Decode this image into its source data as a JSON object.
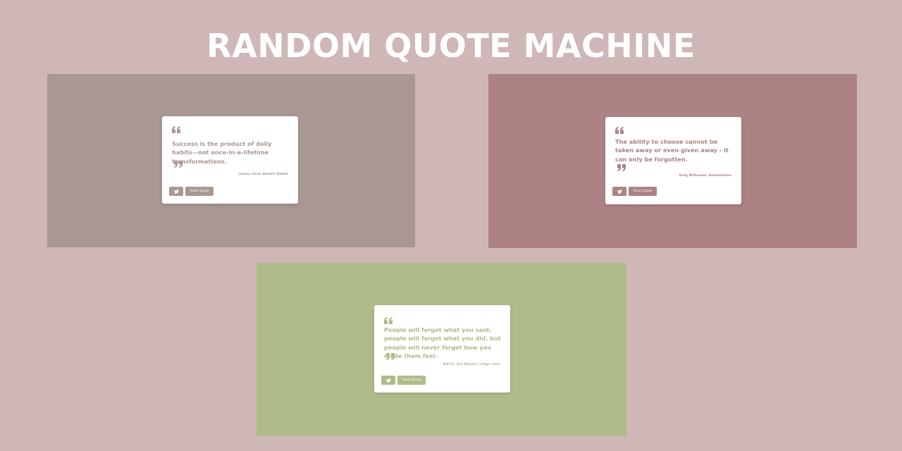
{
  "page": {
    "title": "RANDOM QUOTE MACHINE",
    "background": "#cfb6b7"
  },
  "panels": [
    {
      "background": "#a99892",
      "accent": "#a99892",
      "quote_icon": "quote-left-icon",
      "close_icon": "quote-right-icon",
      "text": "Success is the product of daily habits—not once-in-a-lifetime transformations.",
      "author": "- James Clear, Atomic Habits",
      "tweet_icon": "twitter-icon",
      "next_label": "Next Quote"
    },
    {
      "background": "#ad8283",
      "accent": "#ad8283",
      "quote_icon": "quote-left-icon",
      "close_icon": "quote-right-icon",
      "text": "The ability to choose cannot be taken away or even given away - it can only be forgotten.",
      "author": "- Greg McKeown, Essentialism",
      "tweet_icon": "twitter-icon",
      "next_label": "Next Quote"
    },
    {
      "background": "#afbc8a",
      "accent": "#afbc8a",
      "quote_icon": "quote-left-icon",
      "close_icon": "quote-right-icon",
      "text": "People will forget what you said, people will forget what you did, but people will never forget how you made them feel.",
      "author": "- IKKYU, Zen Master: Ichigo Ichie",
      "tweet_icon": "twitter-icon",
      "next_label": "Next Quote"
    }
  ]
}
